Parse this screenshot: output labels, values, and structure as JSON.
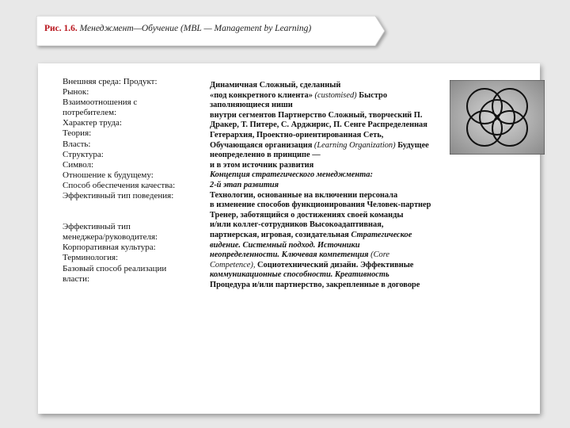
{
  "header": {
    "figure_label": "Рис. 1.6.",
    "figure_title": "Менеджмент—Обучение (MBL — Management by Learning)"
  },
  "left_column": {
    "block1": [
      "Внешняя среда: Продукт:",
      "Рынок:",
      "Взаимоотношения с",
      "потребителем:",
      "Характер труда:",
      "Теория:",
      "Власть:",
      "Структура:",
      "Символ:",
      "Отношение к будущему:",
      "Способ обеспечения качества:",
      "Эффективный тип поведения:"
    ],
    "block2": [
      "Эффективный тип",
      "менеджера/руководителя:",
      "Корпоративная культура:",
      "Терминология:",
      "Базовый способ реализации",
      "власти:"
    ]
  },
  "right_column": {
    "l1": "Динамичная Сложный, сделанный",
    "l2a": "«под конкретного клиента» ",
    "l2b": "(customised)",
    "l2c": " Быстро",
    "l3": "заполняющиеся ниши",
    "l4": "внутри сегментов Партнерство Сложный, творческий П.",
    "l5": "Дракер, Т. Питере, С. Арджирис, П. Сенге Распределенная",
    "l6": "Гетерархия, Проектно-ориентированная Сеть,",
    "l7a": "Обучающаяся организация ",
    "l7b": "(Learning Organization)",
    "l7c": " Будущее",
    "l8": "неопределенно в принципе —",
    "l9": "и в этом источник развития",
    "l10": "Концепция стратегического менеджмента:",
    "l11": "2-й этап развития",
    "l12": "Технологии, основанные на включении персонала",
    "l13": "в изменение способов функционирования Человек-партнер",
    "l14": "Тренер, заботящийся о достижениях своей команды",
    "l15": "и/или коллег-сотрудников Высокоадаптивная,",
    "l16a": "партнерская, игровая, созидательная ",
    "l16b": "Стратегическое",
    "l17": "видение. Системный подход. Источники",
    "l18a": "неопределенности. Ключевая компетенция ",
    "l18b": "(Core",
    "l19a": "Competence), ",
    "l19b": "Социотехнический дизайн. Эффективные",
    "l20": "коммуникационные способности. Креативность",
    "l21": "Процедура и/или партнерство, закрепленные в договоре"
  },
  "diagram": {
    "description_icon": "overlapping-circles-icon",
    "circle_count": 5
  },
  "colors": {
    "figure_label": "#b8141c",
    "background": "#e8e8e8",
    "card": "#ffffff"
  }
}
